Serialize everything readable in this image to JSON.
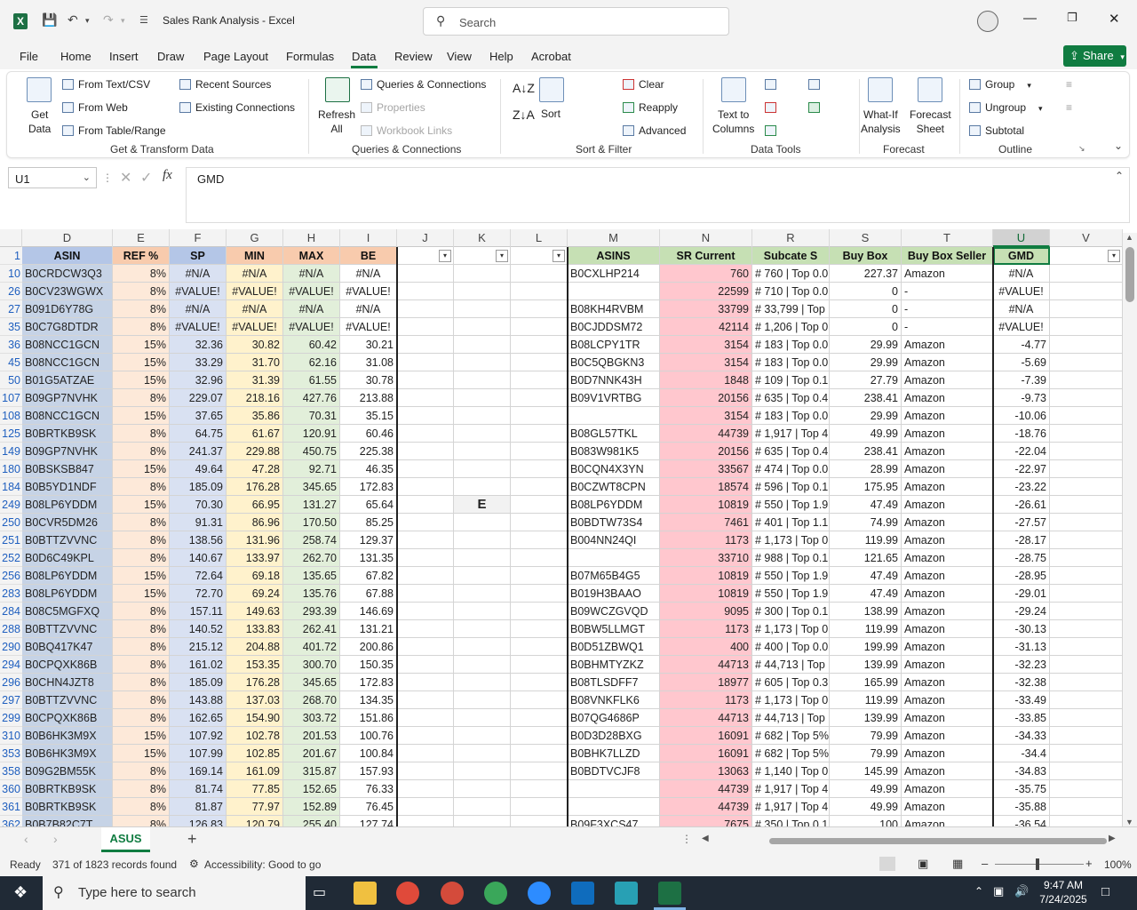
{
  "window": {
    "title": "Sales Rank Analysis  -  Excel",
    "search_placeholder": "Search"
  },
  "menu": [
    "File",
    "Home",
    "Insert",
    "Draw",
    "Page Layout",
    "Formulas",
    "Data",
    "Review",
    "View",
    "Help",
    "Acrobat"
  ],
  "share_label": "Share",
  "ribbon": {
    "get_data": "Get\nData",
    "from_text": "From Text/CSV",
    "from_web": "From Web",
    "from_table": "From Table/Range",
    "recent": "Recent Sources",
    "existing": "Existing Connections",
    "group_get": "Get & Transform Data",
    "refresh": "Refresh\nAll",
    "queries": "Queries & Connections",
    "properties": "Properties",
    "workbook_links": "Workbook Links",
    "group_queries": "Queries & Connections",
    "sort": "Sort",
    "filter": "Filter",
    "clear": "Clear",
    "reapply": "Reapply",
    "advanced": "Advanced",
    "group_sort": "Sort & Filter",
    "text_to_cols": "Text to\nColumns",
    "group_tools": "Data Tools",
    "whatif": "What-If\nAnalysis",
    "forecast_sheet": "Forecast\nSheet",
    "group_forecast": "Forecast",
    "group": "Group",
    "ungroup": "Ungroup",
    "subtotal": "Subtotal",
    "group_outline": "Outline"
  },
  "formula": {
    "name_box": "U1",
    "value": "GMD"
  },
  "columns": [
    "D",
    "E",
    "F",
    "G",
    "H",
    "I",
    "J",
    "K",
    "L",
    "M",
    "N",
    "R",
    "S",
    "T",
    "U",
    "V"
  ],
  "headers": {
    "D": "ASIN",
    "E": "REF %",
    "F": "SP",
    "G": "MIN",
    "H": "MAX",
    "I": "BE",
    "M": "ASINS",
    "N": "SR Current",
    "R": "Subcate S",
    "S": "Buy Box",
    "T": "Buy Box Seller",
    "U": "GMD"
  },
  "k_cell": "E",
  "rows": [
    [
      "10",
      "B0CRDCW3Q3",
      "8%",
      "#N/A",
      "#N/A",
      "#N/A",
      "#N/A",
      "B0CXLHP214",
      "760",
      "# 760 | Top 0.0",
      "227.37",
      "Amazon",
      "#N/A"
    ],
    [
      "26",
      "B0CV23WGWX",
      "8%",
      "#VALUE!",
      "#VALUE!",
      "#VALUE!",
      "#VALUE!",
      "",
      "22599",
      "# 710 | Top 0.0",
      "0",
      "-",
      "#VALUE!"
    ],
    [
      "27",
      "B091D6Y78G",
      "8%",
      "#N/A",
      "#N/A",
      "#N/A",
      "#N/A",
      "B08KH4RVBM",
      "33799",
      "# 33,799 | Top",
      "0",
      "-",
      "#N/A"
    ],
    [
      "35",
      "B0C7G8DTDR",
      "8%",
      "#VALUE!",
      "#VALUE!",
      "#VALUE!",
      "#VALUE!",
      "B0CJDDSM72",
      "42114",
      "# 1,206 | Top 0",
      "0",
      "-",
      "#VALUE!"
    ],
    [
      "36",
      "B08NCC1GCN",
      "15%",
      "32.36",
      "30.82",
      "60.42",
      "30.21",
      "B08LCPY1TR",
      "3154",
      "# 183 | Top 0.0",
      "29.99",
      "Amazon",
      "-4.77"
    ],
    [
      "45",
      "B08NCC1GCN",
      "15%",
      "33.29",
      "31.70",
      "62.16",
      "31.08",
      "B0C5QBGKN3",
      "3154",
      "# 183 | Top 0.0",
      "29.99",
      "Amazon",
      "-5.69"
    ],
    [
      "50",
      "B01G5ATZAE",
      "15%",
      "32.96",
      "31.39",
      "61.55",
      "30.78",
      "B0D7NNK43H",
      "1848",
      "# 109 | Top 0.1",
      "27.79",
      "Amazon",
      "-7.39"
    ],
    [
      "107",
      "B09GP7NVHK",
      "8%",
      "229.07",
      "218.16",
      "427.76",
      "213.88",
      "B09V1VRTBG",
      "20156",
      "# 635 | Top 0.4",
      "238.41",
      "Amazon",
      "-9.73"
    ],
    [
      "108",
      "B08NCC1GCN",
      "15%",
      "37.65",
      "35.86",
      "70.31",
      "35.15",
      "",
      "3154",
      "# 183 | Top 0.0",
      "29.99",
      "Amazon",
      "-10.06"
    ],
    [
      "125",
      "B0BRTKB9SK",
      "8%",
      "64.75",
      "61.67",
      "120.91",
      "60.46",
      "B08GL57TKL",
      "44739",
      "# 1,917 | Top 4",
      "49.99",
      "Amazon",
      "-18.76"
    ],
    [
      "149",
      "B09GP7NVHK",
      "8%",
      "241.37",
      "229.88",
      "450.75",
      "225.38",
      "B083W981K5",
      "20156",
      "# 635 | Top 0.4",
      "238.41",
      "Amazon",
      "-22.04"
    ],
    [
      "180",
      "B0BSKSB847",
      "15%",
      "49.64",
      "47.28",
      "92.71",
      "46.35",
      "B0CQN4X3YN",
      "33567",
      "# 474 | Top 0.0",
      "28.99",
      "Amazon",
      "-22.97"
    ],
    [
      "184",
      "B0B5YD1NDF",
      "8%",
      "185.09",
      "176.28",
      "345.65",
      "172.83",
      "B0CZWT8CPN",
      "18574",
      "# 596 | Top 0.1",
      "175.95",
      "Amazon",
      "-23.22"
    ],
    [
      "249",
      "B08LP6YDDM",
      "15%",
      "70.30",
      "66.95",
      "131.27",
      "65.64",
      "B08LP6YDDM",
      "10819",
      "# 550 | Top 1.9",
      "47.49",
      "Amazon",
      "-26.61"
    ],
    [
      "250",
      "B0CVR5DM26",
      "8%",
      "91.31",
      "86.96",
      "170.50",
      "85.25",
      "B0BDTW73S4",
      "7461",
      "# 401 | Top 1.1",
      "74.99",
      "Amazon",
      "-27.57"
    ],
    [
      "251",
      "B0BTTZVVNC",
      "8%",
      "138.56",
      "131.96",
      "258.74",
      "129.37",
      "B004NN24QI",
      "1173",
      "# 1,173 | Top 0",
      "119.99",
      "Amazon",
      "-28.17"
    ],
    [
      "252",
      "B0D6C49KPL",
      "8%",
      "140.67",
      "133.97",
      "262.70",
      "131.35",
      "",
      "33710",
      "# 988 | Top 0.1",
      "121.65",
      "Amazon",
      "-28.75"
    ],
    [
      "256",
      "B08LP6YDDM",
      "15%",
      "72.64",
      "69.18",
      "135.65",
      "67.82",
      "B07M65B4G5",
      "10819",
      "# 550 | Top 1.9",
      "47.49",
      "Amazon",
      "-28.95"
    ],
    [
      "283",
      "B08LP6YDDM",
      "15%",
      "72.70",
      "69.24",
      "135.76",
      "67.88",
      "B019H3BAAO",
      "10819",
      "# 550 | Top 1.9",
      "47.49",
      "Amazon",
      "-29.01"
    ],
    [
      "284",
      "B08C5MGFXQ",
      "8%",
      "157.11",
      "149.63",
      "293.39",
      "146.69",
      "B09WCZGVQD",
      "9095",
      "# 300 | Top 0.1",
      "138.99",
      "Amazon",
      "-29.24"
    ],
    [
      "288",
      "B0BTTZVVNC",
      "8%",
      "140.52",
      "133.83",
      "262.41",
      "131.21",
      "B0BW5LLMGT",
      "1173",
      "# 1,173 | Top 0",
      "119.99",
      "Amazon",
      "-30.13"
    ],
    [
      "290",
      "B0BQ417K47",
      "8%",
      "215.12",
      "204.88",
      "401.72",
      "200.86",
      "B0D51ZBWQ1",
      "400",
      "# 400 | Top 0.0",
      "199.99",
      "Amazon",
      "-31.13"
    ],
    [
      "294",
      "B0CPQXK86B",
      "8%",
      "161.02",
      "153.35",
      "300.70",
      "150.35",
      "B0BHMTYZKZ",
      "44713",
      "# 44,713 | Top",
      "139.99",
      "Amazon",
      "-32.23"
    ],
    [
      "296",
      "B0CHN4JZT8",
      "8%",
      "185.09",
      "176.28",
      "345.65",
      "172.83",
      "B08TLSDFF7",
      "18977",
      "# 605 | Top 0.3",
      "165.99",
      "Amazon",
      "-32.38"
    ],
    [
      "297",
      "B0BTTZVVNC",
      "8%",
      "143.88",
      "137.03",
      "268.70",
      "134.35",
      "B08VNKFLK6",
      "1173",
      "# 1,173 | Top 0",
      "119.99",
      "Amazon",
      "-33.49"
    ],
    [
      "299",
      "B0CPQXK86B",
      "8%",
      "162.65",
      "154.90",
      "303.72",
      "151.86",
      "B07QG4686P",
      "44713",
      "# 44,713 | Top",
      "139.99",
      "Amazon",
      "-33.85"
    ],
    [
      "310",
      "B0B6HK3M9X",
      "15%",
      "107.92",
      "102.78",
      "201.53",
      "100.76",
      "B0D3D28BXG",
      "16091",
      "# 682 | Top 5%",
      "79.99",
      "Amazon",
      "-34.33"
    ],
    [
      "353",
      "B0B6HK3M9X",
      "15%",
      "107.99",
      "102.85",
      "201.67",
      "100.84",
      "B0BHK7LLZD",
      "16091",
      "# 682 | Top 5%",
      "79.99",
      "Amazon",
      "-34.4"
    ],
    [
      "358",
      "B09G2BM55K",
      "8%",
      "169.14",
      "161.09",
      "315.87",
      "157.93",
      "B0BDTVCJF8",
      "13063",
      "# 1,140 | Top 0",
      "145.99",
      "Amazon",
      "-34.83"
    ],
    [
      "360",
      "B0BRTKB9SK",
      "8%",
      "81.74",
      "77.85",
      "152.65",
      "76.33",
      "",
      "44739",
      "# 1,917 | Top 4",
      "49.99",
      "Amazon",
      "-35.75"
    ],
    [
      "361",
      "B0BRTKB9SK",
      "8%",
      "81.87",
      "77.97",
      "152.89",
      "76.45",
      "",
      "44739",
      "# 1,917 | Top 4",
      "49.99",
      "Amazon",
      "-35.88"
    ],
    [
      "362",
      "B0B7B82C7T",
      "8%",
      "126.83",
      "120.79",
      "255.40",
      "127.74",
      "B09F3XCS47",
      "7675",
      "# 350 | Top 0.1",
      "100",
      "Amazon",
      "-36.54"
    ]
  ],
  "sheet_tab": "ASUS",
  "status": {
    "ready": "Ready",
    "records": "371 of 1823 records found",
    "accessibility": "Accessibility: Good to go",
    "zoom": "100%"
  },
  "taskbar": {
    "search_placeholder": "Type here to search",
    "time": "9:47 AM",
    "date": "7/24/2025"
  },
  "colors": {
    "excel_green": "#107c41",
    "asin_fill": "#c6d3e6",
    "ref_fill": "#fde9d9",
    "sp_fill": "#d9e1f2",
    "min_fill": "#fff2cc",
    "max_fill": "#e2efda",
    "sr_fill": "#ffc7ce",
    "hdr_blue": "#b4c6e7",
    "hdr_orange": "#f8cbad",
    "hdr_green": "#c6e0b4"
  }
}
